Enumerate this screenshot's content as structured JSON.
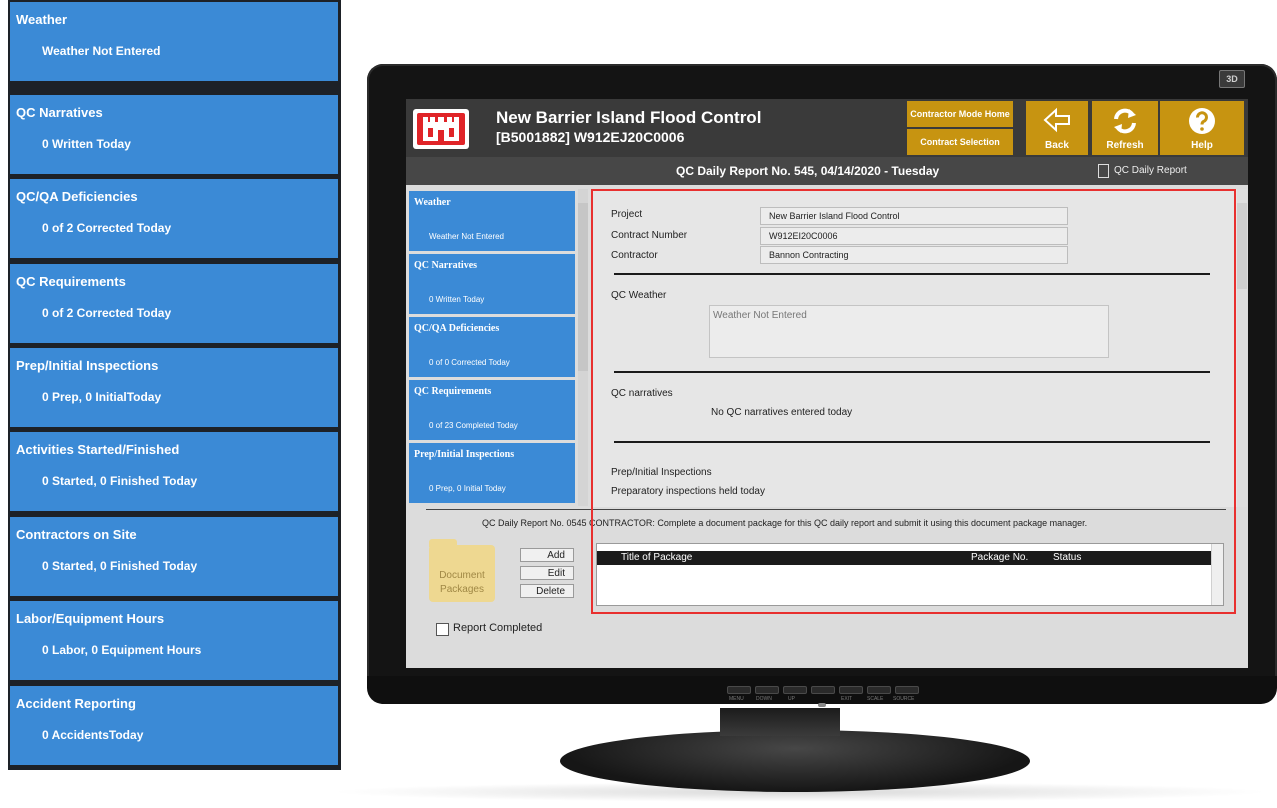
{
  "left_panel": {
    "tiles": [
      {
        "title": "Weather",
        "status": "Weather Not Entered"
      },
      {
        "title": "QC Narratives",
        "status": "0 Written Today"
      },
      {
        "title": "QC/QA Deficiencies",
        "status": "0 of 2 Corrected Today"
      },
      {
        "title": "QC Requirements",
        "status": "0 of 2 Corrected Today"
      },
      {
        "title": "Prep/Initial Inspections",
        "status": "0 Prep, 0 InitialToday"
      },
      {
        "title": "Activities Started/Finished",
        "status": "0 Started, 0 Finished Today"
      },
      {
        "title": "Contractors on Site",
        "status": "0 Started, 0 Finished Today"
      },
      {
        "title": "Labor/Equipment Hours",
        "status": "0 Labor, 0 Equipment Hours"
      },
      {
        "title": "Accident Reporting",
        "status": "0 AccidentsToday"
      }
    ]
  },
  "monitor": {
    "badge": "3D",
    "controls": [
      "MENU",
      "DOWN",
      "UP",
      "",
      "EXIT",
      "SCALE",
      "SOURCE"
    ]
  },
  "header": {
    "project_title": "New Barrier Island Flood Control",
    "project_subtitle": "[B5001882] W912EJ20C0006",
    "contractor_home": "Contractor Mode Home",
    "contract_selection": "Contract Selection",
    "back": "Back",
    "refresh": "Refresh",
    "help": "Help"
  },
  "report_bar": {
    "title": "QC Daily Report No. 545, 04/14/2020 - Tuesday",
    "link": "QC Daily Report"
  },
  "nav": {
    "items": [
      {
        "title": "Weather",
        "status": "Weather Not Entered"
      },
      {
        "title": "QC Narratives",
        "status": "0 Written Today"
      },
      {
        "title": "QC/QA Deficiencies",
        "status": "0 of 0 Corrected Today"
      },
      {
        "title": "QC Requirements",
        "status": "0 of 23 Completed Today"
      },
      {
        "title": "Prep/Initial Inspections",
        "status": "0 Prep, 0 Initial Today"
      }
    ]
  },
  "detail": {
    "project_label": "Project",
    "project_value": "New Barrier Island Flood Control",
    "contract_label": "Contract Number",
    "contract_value": "W912EI20C0006",
    "contractor_label": "Contractor",
    "contractor_value": "Bannon Contracting",
    "weather_label": "QC Weather",
    "weather_value": "Weather Not Entered",
    "narratives_label": "QC narratives",
    "narratives_value": "No QC narratives entered today",
    "prep_label": "Prep/Initial Inspections",
    "prep_value": "Preparatory inspections held today"
  },
  "packages": {
    "instruction": "QC Daily Report No. 0545  CONTRACTOR: Complete a document package for this QC daily report and submit it using this document package manager.",
    "folder_label_1": "Document",
    "folder_label_2": "Packages",
    "add": "Add",
    "edit": "Edit",
    "delete": "Delete",
    "columns": [
      "Title of Package",
      "Package No.",
      "Status"
    ]
  },
  "footer": {
    "report_completed": "Report Completed"
  },
  "colors": {
    "tile_blue": "#3b8ad6",
    "gold": "#c79411",
    "header_dark": "#3a3a3a",
    "highlight_red": "#e8302f"
  }
}
